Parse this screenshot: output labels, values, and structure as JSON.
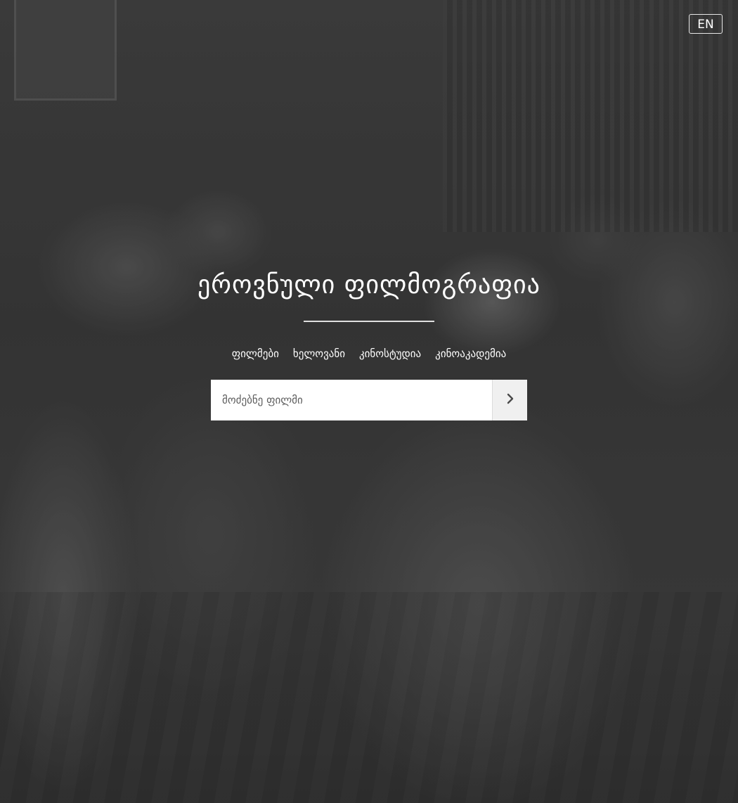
{
  "header": {
    "language_button": "EN"
  },
  "hero": {
    "title": "ეროვნული ფილმოგრაფია"
  },
  "nav": {
    "items": [
      {
        "label": "ფილმები"
      },
      {
        "label": "ხელოვანი"
      },
      {
        "label": "კინოსტუდია"
      },
      {
        "label": "კინოაკადემია"
      }
    ]
  },
  "search": {
    "placeholder": "მოძებნე ფილმი",
    "value": "",
    "submit_icon": "chevron-right-icon"
  },
  "colors": {
    "text": "#ffffff",
    "overlay": "#000000",
    "search_bg": "#ffffff",
    "button_bg": "#f0f0f0"
  }
}
